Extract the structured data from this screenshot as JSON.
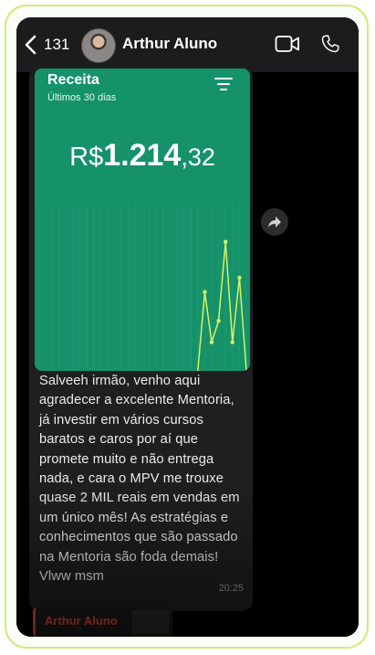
{
  "header": {
    "back_count": "131",
    "contact_name": "Arthur Aluno"
  },
  "receipt": {
    "title": "Receita",
    "subtitle": "Últimos 30 dias",
    "amount_currency": "R$",
    "amount_integer": "1.214",
    "amount_cents": ",32"
  },
  "chart_data": {
    "type": "line",
    "values": [
      0,
      0,
      0,
      0,
      0,
      0,
      0,
      0,
      0,
      0,
      0,
      0,
      0,
      0,
      0,
      0,
      0,
      0,
      0,
      0,
      0,
      0,
      0,
      0,
      0.55,
      0.2,
      0.35,
      0.9,
      0.2,
      0.65,
      0
    ],
    "line_color": "#d8f265"
  },
  "message": {
    "text": "Salveeh irmão, venho aqui agradecer a excelente Mentoria, já investir em vários cursos baratos e caros por aí que promete muito e não entrega nada, e cara o MPV me trouxe quase 2 MIL reais em vendas em um único mês! As estratégias e conhecimentos que são passado na Mentoria são foda demais! Vlww msm",
    "time": "20:25"
  },
  "next_message": {
    "name": "Arthur Aluno"
  },
  "colors": {
    "accent_green": "#15926a",
    "frame_border": "#c9ee7a",
    "reply_red": "#e0463c"
  }
}
